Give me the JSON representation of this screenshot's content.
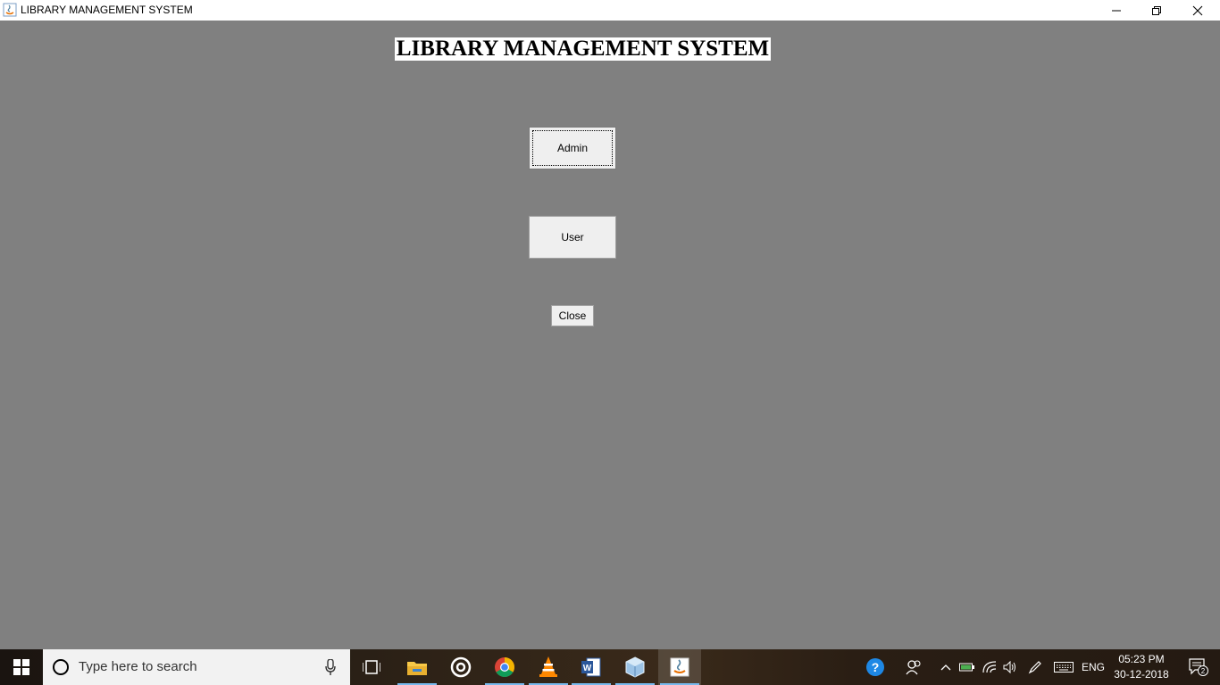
{
  "window": {
    "title": "LIBRARY MANAGEMENT SYSTEM",
    "icon": "java-icon",
    "controls": [
      "minimize-icon",
      "restore-icon",
      "close-icon"
    ]
  },
  "main": {
    "heading": "LIBRARY MANAGEMENT SYSTEM",
    "buttons": {
      "admin": "Admin",
      "user": "User",
      "close": "Close"
    },
    "focused_button": "Admin"
  },
  "taskbar": {
    "search_placeholder": "Type here to search",
    "apps": [
      "task-view-icon",
      "file-explorer-icon",
      "app-circle-icon",
      "chrome-icon",
      "vlc-icon",
      "word-icon",
      "box-app-icon",
      "java-icon"
    ],
    "active_app": "java-icon",
    "tray": {
      "icons": [
        "help-icon",
        "people-icon",
        "chevron-up-icon",
        "battery-icon",
        "wifi-icon",
        "volume-icon",
        "pen-icon",
        "keyboard-icon"
      ],
      "language": "ENG",
      "time": "05:23 PM",
      "date": "30-12-2018",
      "notification_count": "2"
    }
  },
  "colors": {
    "window_bg": "#808080",
    "button_bg": "#efefef",
    "heading_bg": "#ffffff"
  }
}
